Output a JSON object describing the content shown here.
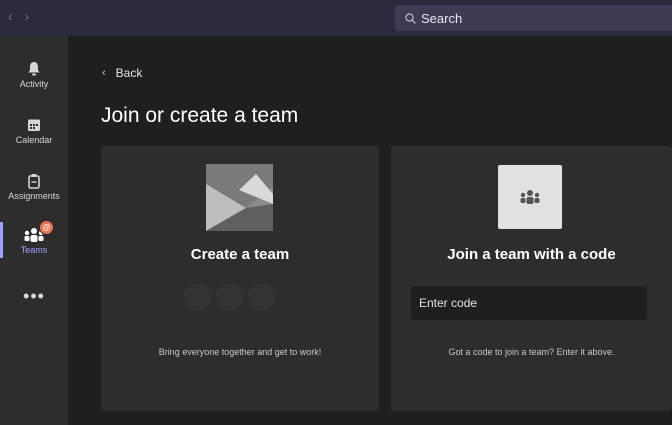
{
  "titlebar": {
    "back_arrow": "‹",
    "forward_arrow": "›",
    "search_placeholder": "Search"
  },
  "rail": {
    "items": [
      {
        "label": "Activity",
        "icon": "bell-icon"
      },
      {
        "label": "Calendar",
        "icon": "calendar-icon"
      },
      {
        "label": "Assignments",
        "icon": "assignments-icon"
      },
      {
        "label": "Teams",
        "icon": "teams-icon",
        "badge": "@"
      }
    ],
    "more_label": "•••"
  },
  "main": {
    "back_label": "Back",
    "title": "Join or create a team",
    "create_card": {
      "title": "Create a team",
      "description": "Bring everyone together and get to work!"
    },
    "join_card": {
      "title": "Join a team with a code",
      "input_placeholder": "Enter code",
      "description": "Got a code to join a team? Enter it above."
    }
  },
  "colors": {
    "accent": "#9ea2ff",
    "badge": "#e8734f",
    "titlebar": "#2b2b40",
    "background": "#1f1f1f",
    "card": "#2d2d2d"
  }
}
